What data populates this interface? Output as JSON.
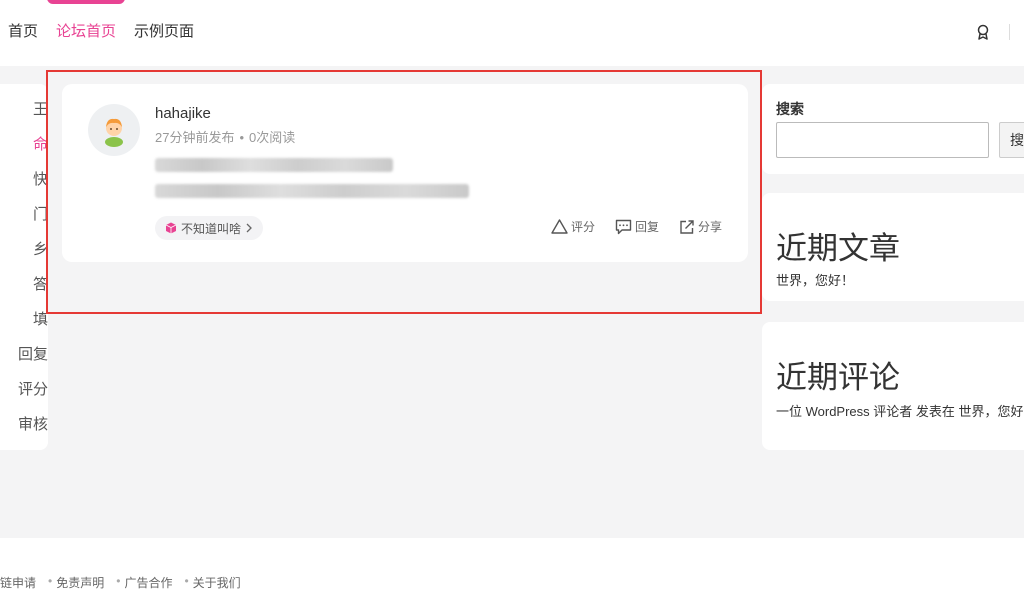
{
  "nav": {
    "items": [
      "首页",
      "论坛首页",
      "示例页面"
    ],
    "active_index": 1
  },
  "left_categories": [
    "王",
    "命",
    "快",
    "门",
    "乡",
    "答",
    "填",
    "回复",
    "评分",
    "审核"
  ],
  "post": {
    "author": "hahajike",
    "time": "27分钟前发布",
    "reads": "0次阅读",
    "tag": "不知道叫啥",
    "actions": {
      "rate": "评分",
      "reply": "回复",
      "share": "分享"
    }
  },
  "sidebar": {
    "search": {
      "label": "搜索",
      "button": "搜索"
    },
    "recent_posts": {
      "title": "近期文章",
      "items": [
        "世界，您好！"
      ]
    },
    "recent_comments": {
      "title": "近期评论",
      "items": [
        "一位 WordPress 评论者 发表在 世界，您好！"
      ]
    }
  },
  "footer": {
    "links": [
      "链申请",
      "免责声明",
      "广告合作",
      "关于我们"
    ]
  },
  "colors": {
    "accent": "#e84393",
    "highlight": "#e53935",
    "background": "#f4f4f5"
  },
  "icons": [
    "award-icon",
    "avatar-icon",
    "cube-icon",
    "chevron-right-icon",
    "triangle-icon",
    "chat-icon",
    "share-icon"
  ]
}
